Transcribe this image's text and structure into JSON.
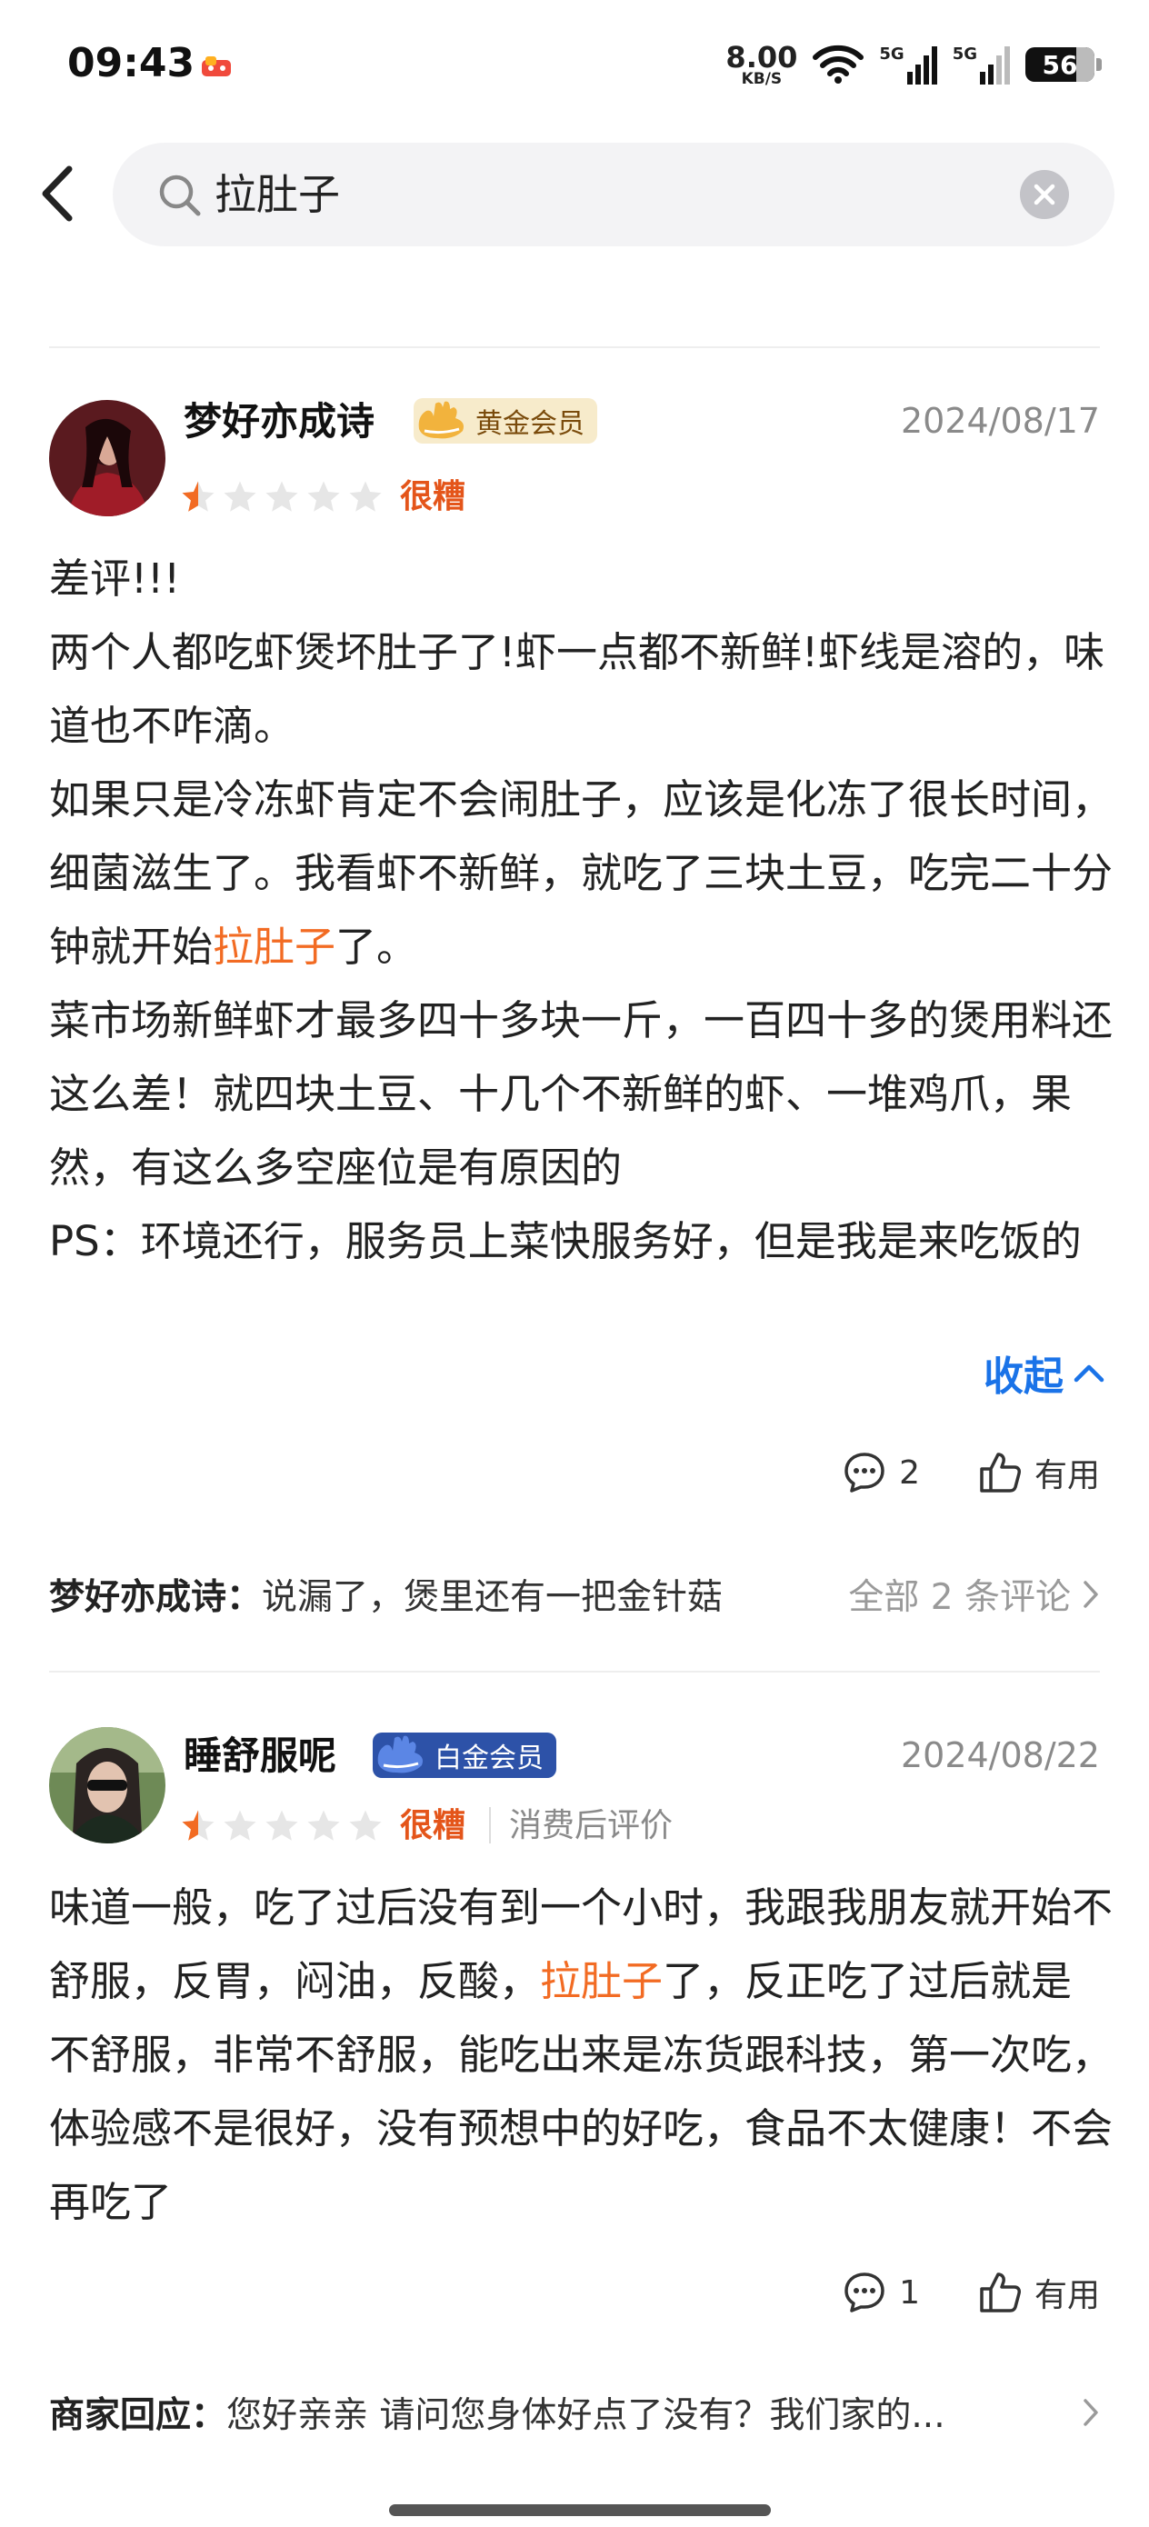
{
  "status_bar": {
    "time": "09:43",
    "net_speed": "8.00",
    "net_unit": "KB/S",
    "signal1": "5G",
    "signal2": "5G",
    "battery": "56"
  },
  "search": {
    "query": "拉肚子"
  },
  "reviews": [
    {
      "user": "梦好亦成诗",
      "badge": "黄金会员",
      "date": "2024/08/17",
      "rating": 1,
      "rating_text": "很糟",
      "p1": "差评!!!",
      "p2": "两个人都吃虾煲坏肚子了!虾一点都不新鲜!虾线是溶的，味道也不咋滴。",
      "p3_before": "如果只是冷冻虾肯定不会闹肚子，应该是化冻了很长时间，细菌滋生了。我看虾不新鲜，就吃了三块土豆，吃完二十分钟就开始",
      "p3_hl": "拉肚子",
      "p3_after": "了。",
      "p4": "菜市场新鲜虾才最多四十多块一斤，一百四十多的煲用料还这么差！就四块土豆、十几个不新鲜的虾、一堆鸡爪，果然，有这么多空座位是有原因的",
      "p5": "PS：环境还行，服务员上菜快服务好，但是我是来吃饭的",
      "collapse_label": "收起",
      "comment_count": "2",
      "useful_label": "有用",
      "reply_who": "梦好亦成诗：",
      "reply_text": "说漏了，煲里还有一把金针菇",
      "reply_more": "全部 2 条评论"
    },
    {
      "user": "睡舒服呢",
      "badge": "白金会员",
      "date": "2024/08/22",
      "rating": 1,
      "rating_text": "很糟",
      "sub_text": "消费后评价",
      "p1_before": "味道一般，吃了过后没有到一个小时，我跟我朋友就开始不舒服，反胃，闷油，反酸，",
      "p1_hl": "拉肚子",
      "p1_after": "了，反正吃了过后就是不舒服，非常不舒服，能吃出来是冻货跟科技，第一次吃，体验感不是很好，没有预想中的好吃，食品不太健康！不会再吃了",
      "comment_count": "1",
      "useful_label": "有用",
      "reply_who": "商家回应：",
      "reply_text": "您好亲亲 请问您身体好点了没有？我们家的..."
    }
  ],
  "colors": {
    "accent_blue": "#1a73e8",
    "rating_orange": "#e4551a",
    "highlight_orange": "#f26b23",
    "gold_badge": "#f7ebcb",
    "platinum_badge": "#2d52a8"
  }
}
